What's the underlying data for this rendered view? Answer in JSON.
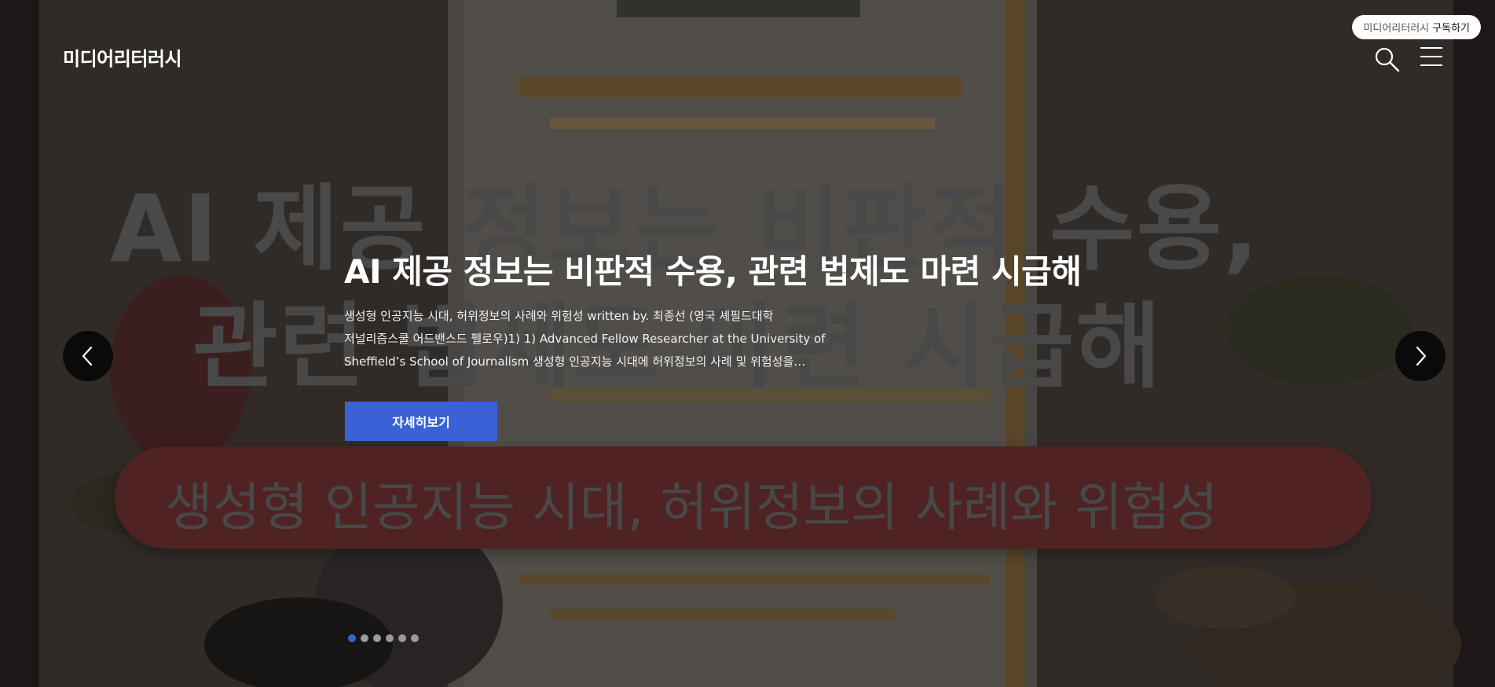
{
  "site": {
    "logo": "미디어리터러시"
  },
  "subscribe": {
    "brand": "미디어리터러시",
    "action": "구독하기"
  },
  "header_icons": {
    "search": "search-icon",
    "menu": "hamburger-menu-icon"
  },
  "background": {
    "title_line_1": "AI 제공 정보는 비판적 수용,",
    "title_line_2": "관련 법제도 마련 시급해",
    "pill_text": "생성형 인공지능 시대, 허위정보의 사례와 위험성"
  },
  "slide": {
    "title": "AI 제공 정보는 비판적 수용, 관련 법제도 마련 시급해",
    "desc_line_1": "생성형 인공지능 시대, 허위정보의 사례와 위험성  written by. 최종선 (영국 셰필드대학",
    "desc_line_2": "저널리즘스쿨 어드밴스드 펠로우)1) 1) Advanced Fellow Researcher at the University of",
    "desc_line_3": "Sheffield’s School of Journalism 생성형 인공지능 시대에 허위정보의 사례 및 위험성을…",
    "button_label": "자세히보기"
  },
  "carousel": {
    "prev": "chevron-left-icon",
    "next": "chevron-right-icon",
    "dot_count": 6,
    "active_index": 0
  },
  "colors": {
    "accent": "#3a62d6",
    "background_pill": "#7a3135"
  }
}
